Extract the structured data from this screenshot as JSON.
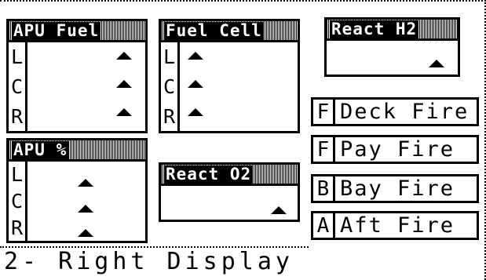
{
  "gauges": {
    "apu_fuel": {
      "title": "APU Fuel",
      "rows": [
        "L",
        "C",
        "R"
      ]
    },
    "fuel_cell": {
      "title": "Fuel Cell",
      "rows": [
        "L",
        "C",
        "R"
      ]
    },
    "react_h2": {
      "title": "React H2"
    },
    "apu_pct": {
      "title": "APU %",
      "rows": [
        "L",
        "C",
        "R"
      ]
    },
    "react_o2": {
      "title": "React O2"
    }
  },
  "fire_buttons": [
    {
      "tag": "F",
      "label": "Deck Fire"
    },
    {
      "tag": "F",
      "label": "Pay Fire"
    },
    {
      "tag": "B",
      "label": "Bay Fire"
    },
    {
      "tag": "A",
      "label": "Aft Fire"
    }
  ],
  "footer": {
    "text": "2- Right Display"
  }
}
